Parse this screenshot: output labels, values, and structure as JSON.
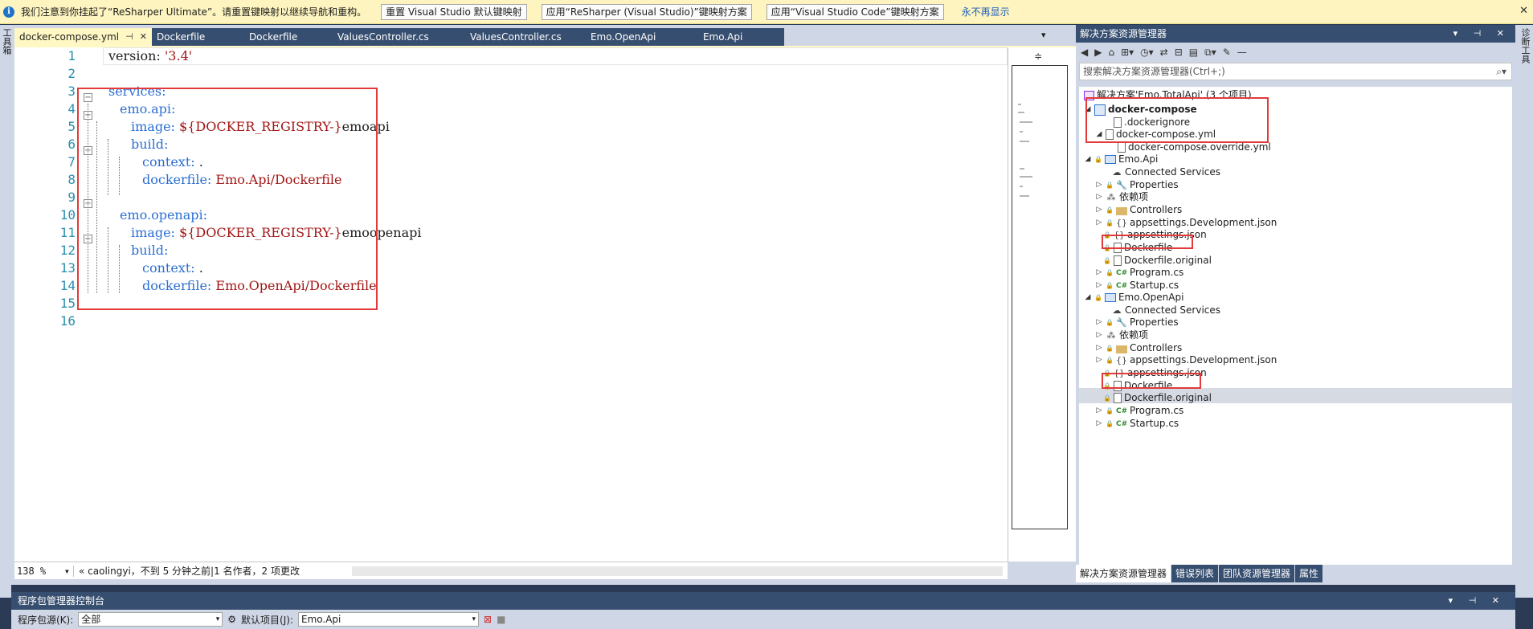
{
  "infobar": {
    "message": "我们注意到你挂起了“ReSharper Ultimate”。请重置键映射以继续导航和重构。",
    "btn_reset": "重置 Visual Studio 默认键映射",
    "btn_apply_resharper": "应用“ReSharper (Visual Studio)”键映射方案",
    "btn_apply_vscode": "应用“Visual Studio Code”键映射方案",
    "link_never": "永不再显示"
  },
  "left_strip_label": "工具箱",
  "right_strip_label": "诊断工具",
  "tabs": [
    {
      "label": "docker-compose.yml",
      "active": true
    },
    {
      "label": "Dockerfile"
    },
    {
      "label": "Dockerfile"
    },
    {
      "label": "ValuesController.cs"
    },
    {
      "label": "ValuesController.cs"
    },
    {
      "label": "Emo.OpenApi"
    },
    {
      "label": "Emo.Api"
    }
  ],
  "line_numbers": [
    "1",
    "2",
    "3",
    "4",
    "5",
    "6",
    "7",
    "8",
    "9",
    "10",
    "11",
    "12",
    "13",
    "14",
    "15",
    "16"
  ],
  "code": {
    "l1_key": "version:",
    "l1_val": " '3.4'",
    "l3": "services:",
    "l4": "emo.api:",
    "l5_key": "image:",
    "l5_val": " ${DOCKER_REGISTRY-}",
    "l5_tail": "emoapi",
    "l6": "build:",
    "l7_key": "context:",
    "l7_val": " .",
    "l8_key": "dockerfile:",
    "l8_val": " Emo.Api/Dockerfile",
    "l10": "emo.openapi:",
    "l11_key": "image:",
    "l11_val": " ${DOCKER_REGISTRY-}",
    "l11_tail": "emoopenapi",
    "l12": "build:",
    "l13_key": "context:",
    "l13_val": " .",
    "l14_key": "dockerfile:",
    "l14_val": " Emo.OpenApi/Dockerfile"
  },
  "status": {
    "zoom": "138 %",
    "git_info": "caolingyi，不到 5 分钟之前|1 名作者，2 项更改"
  },
  "solution_explorer": {
    "title": "解决方案资源管理器",
    "search_placeholder": "搜索解决方案资源管理器(Ctrl+;)",
    "solution_label": "解决方案'Emo.TotalApi' (3 个项目)",
    "items": [
      "docker-compose",
      ".dockerignore",
      "docker-compose.yml",
      "docker-compose.override.yml",
      "Emo.Api",
      "Connected Services",
      "Properties",
      "依赖项",
      "Controllers",
      "appsettings.Development.json",
      "appsettings.json",
      "Dockerfile",
      "Dockerfile.original",
      "Program.cs",
      "Startup.cs",
      "Emo.OpenApi",
      "Connected Services",
      "Properties",
      "依赖项",
      "Controllers",
      "appsettings.Development.json",
      "appsettings.json",
      "Dockerfile",
      "Dockerfile.original",
      "Program.cs",
      "Startup.cs"
    ],
    "bottom_tabs": [
      "解决方案资源管理器",
      "错误列表",
      "团队资源管理器",
      "属性"
    ]
  },
  "package_manager": {
    "title": "程序包管理器控制台",
    "source_label": "程序包源(K):",
    "source_value": "全部",
    "project_label": "默认项目(J):",
    "project_value": "Emo.Api"
  }
}
